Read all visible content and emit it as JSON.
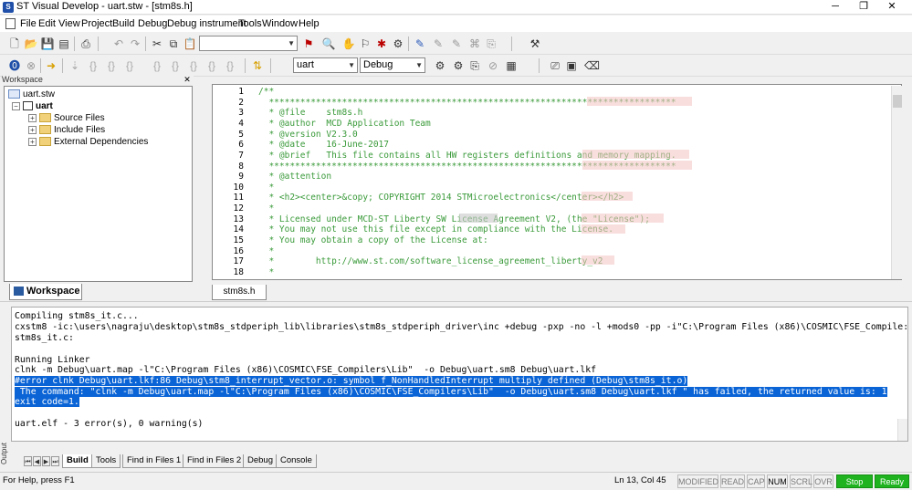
{
  "window": {
    "title": "ST Visual Develop - uart.stw - [stm8s.h]",
    "min": "─",
    "restore": "❐",
    "close": "✕"
  },
  "menu": [
    "File",
    "Edit",
    "View",
    "Project",
    "Build",
    "Debug",
    "Debug instrument",
    "Tools",
    "Window",
    "Help"
  ],
  "toolbar2": {
    "project_combo": "uart",
    "config_combo": "Debug"
  },
  "workspace": {
    "header": "Workspace",
    "tab": "Workspace",
    "tree": {
      "root": "uart.stw",
      "project": "uart",
      "folders": [
        "Source Files",
        "Include Files",
        "External Dependencies"
      ]
    }
  },
  "editor": {
    "tab": "stm8s.h",
    "lines": [
      {
        "n": "1",
        "text": "/**"
      },
      {
        "n": "2",
        "text": "  ******************************************************************************"
      },
      {
        "n": "3",
        "text": "  * @file    stm8s.h"
      },
      {
        "n": "4",
        "text": "  * @author  MCD Application Team"
      },
      {
        "n": "5",
        "text": "  * @version V2.3.0"
      },
      {
        "n": "6",
        "text": "  * @date    16-June-2017"
      },
      {
        "n": "7",
        "text": "  * @brief   This file contains all HW registers definitions and memory mapping."
      },
      {
        "n": "8",
        "text": "  ******************************************************************************"
      },
      {
        "n": "9",
        "text": "  * @attention"
      },
      {
        "n": "10",
        "text": "  *"
      },
      {
        "n": "11",
        "text": "  * <h2><center>&copy; COPYRIGHT 2014 STMicroelectronics</center></h2>"
      },
      {
        "n": "12",
        "text": "  *"
      },
      {
        "n": "13",
        "text": "  * Licensed under MCD-ST Liberty SW License Agreement V2, (the \"License\");"
      },
      {
        "n": "14",
        "text": "  * You may not use this file except in compliance with the License."
      },
      {
        "n": "15",
        "text": "  * You may obtain a copy of the License at:"
      },
      {
        "n": "16",
        "text": "  *"
      },
      {
        "n": "17",
        "text": "  *        http://www.st.com/software_license_agreement_liberty_v2"
      },
      {
        "n": "18",
        "text": "  *"
      }
    ]
  },
  "output": {
    "label": "Output",
    "lines": [
      "Compiling stm8s_it.c...",
      "cxstm8 -ic:\\users\\nagraju\\desktop\\stm8s_stdperiph_lib\\libraries\\stm8s_stdperiph_driver\\inc +debug -pxp -no -l +mods0 -pp -i\"C:\\Program Files (x86)\\COSMIC\\FSE_Compile:",
      "stm8s_it.c:",
      "",
      "Running Linker",
      "clnk -m Debug\\uart.map -l\"C:\\Program Files (x86)\\COSMIC\\FSE_Compilers\\Lib\"  -o Debug\\uart.sm8 Debug\\uart.lkf",
      "#error clnk Debug\\uart.lkf:86 Debug\\stm8_interrupt_vector.o: symbol f_NonHandledInterrupt multiply defined (Debug\\stm8s_it.o)",
      " The command: \"clnk -m Debug\\uart.map -l\"C:\\Program Files (x86)\\COSMIC\\FSE_Compilers\\Lib\"  -o Debug\\uart.sm8 Debug\\uart.lkf \" has failed, the returned value is: 1",
      "exit code=1.",
      "",
      "uart.elf - 3 error(s), 0 warning(s)"
    ],
    "tabs": [
      "Build",
      "Tools",
      "Find in Files 1",
      "Find in Files 2",
      "Debug",
      "Console"
    ]
  },
  "status": {
    "help": "For Help, press F1",
    "position": "Ln 13, Col 45",
    "indicators": [
      "MODIFIED",
      "READ",
      "CAP",
      "NUM",
      "SCRL",
      "OVR"
    ],
    "stop": "Stop",
    "ready": "Ready"
  }
}
